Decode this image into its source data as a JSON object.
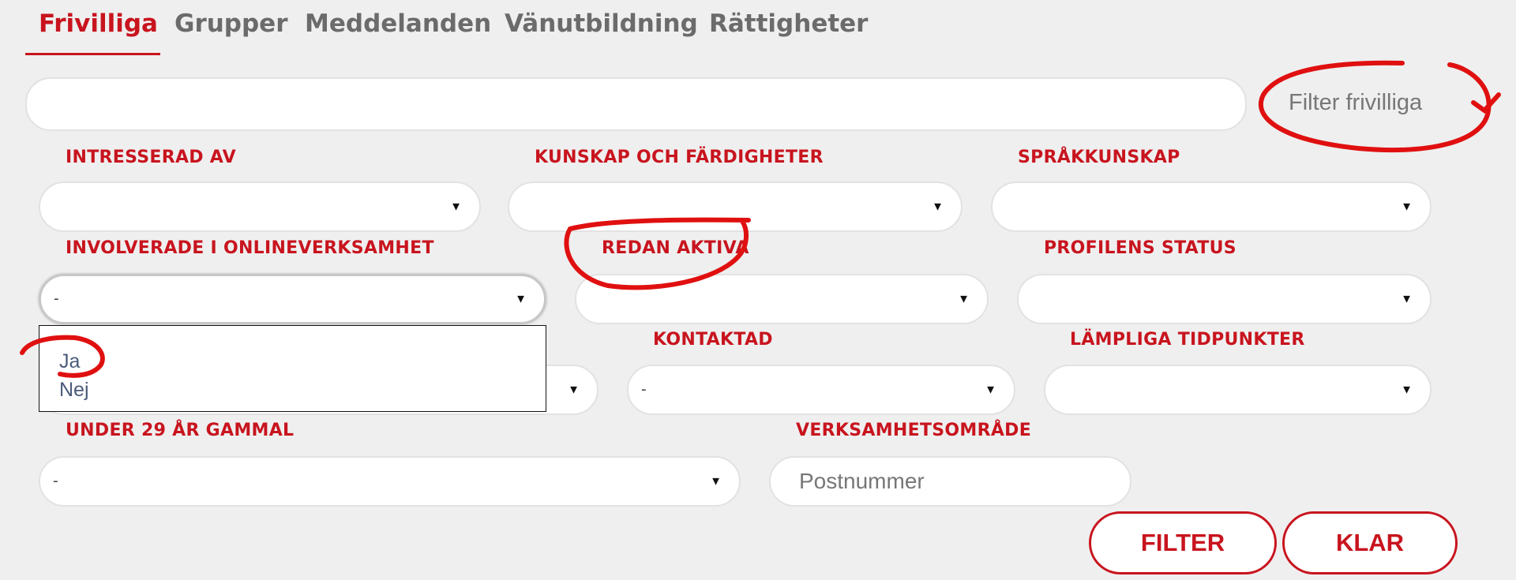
{
  "tabs": [
    {
      "label": "Frivilliga",
      "active": true
    },
    {
      "label": "Grupper",
      "active": false
    },
    {
      "label": "Meddelanden",
      "active": false
    },
    {
      "label": "Vänutbildning",
      "active": false
    },
    {
      "label": "Rättigheter",
      "active": false
    }
  ],
  "search": {
    "value": ""
  },
  "filter_select": {
    "placeholder": "Filter frivilliga"
  },
  "filters": {
    "interested_in": {
      "label": "INTRESSERAD AV",
      "value": ""
    },
    "skills": {
      "label": "KUNSKAP OCH FÄRDIGHETER",
      "value": ""
    },
    "languages": {
      "label": "SPRÅKKUNSKAP",
      "value": ""
    },
    "online_involved": {
      "label": "INVOLVERADE I ONLINEVERKSAMHET",
      "value": "-",
      "options": [
        "Ja",
        "Nej"
      ]
    },
    "already_active": {
      "label": "REDAN AKTIVA",
      "value": ""
    },
    "profile_status": {
      "label": "PROFILENS STATUS",
      "value": ""
    },
    "hidden_row3_first": {
      "label": "",
      "value": ""
    },
    "contacted": {
      "label": "KONTAKTAD",
      "value": "-"
    },
    "suitable_times": {
      "label": "LÄMPLIGA TIDPUNKTER",
      "value": ""
    },
    "under_29": {
      "label": "UNDER 29 ÅR GAMMAL",
      "value": "-"
    },
    "area": {
      "label": "VERKSAMHETSOMRÅDE",
      "placeholder": "Postnummer"
    }
  },
  "buttons": {
    "filter": "FILTER",
    "clear": "KLAR"
  },
  "icons": {
    "caret": "▼"
  },
  "colors": {
    "accent": "#c8141e",
    "annotation": "#e01010",
    "background": "#efefef"
  }
}
